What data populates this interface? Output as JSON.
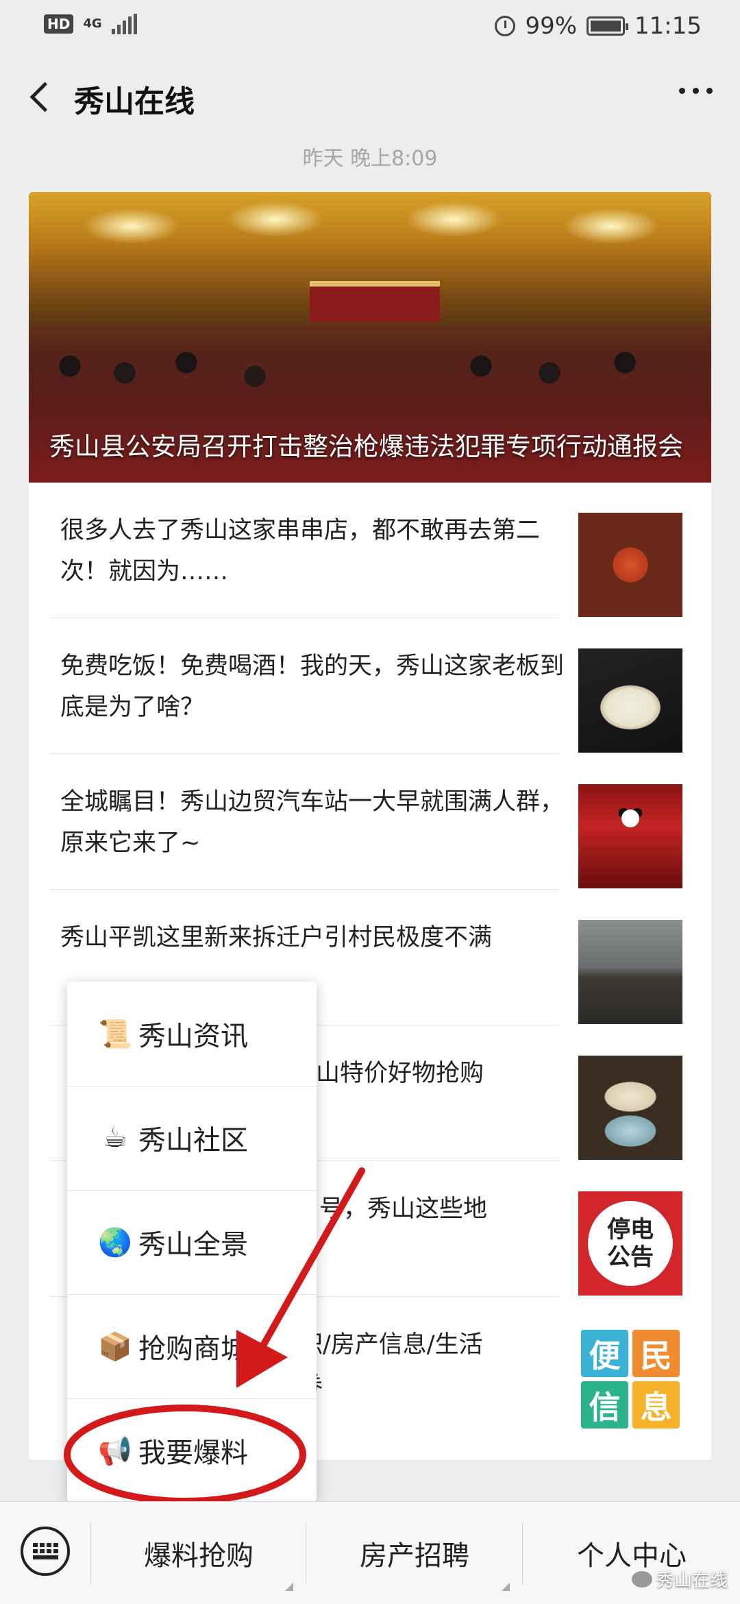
{
  "status_bar": {
    "hd": "HD",
    "network": "4G",
    "battery_percent": "99%",
    "time": "11:15"
  },
  "header": {
    "title": "秀山在线"
  },
  "message": {
    "timestamp": "昨天 晚上8:09",
    "hero_title": "秀山县公安局召开打击整治枪爆违法犯罪专项行动通报会",
    "articles": [
      {
        "title": "很多人去了秀山这家串串店，都不敢再去第二次！就因为……",
        "thumb": "food-icon"
      },
      {
        "title": "免费吃饭！免费喝酒！我的天，秀山这家老板到底是为了啥？",
        "thumb": "rice-icon"
      },
      {
        "title": "全城瞩目！秀山边贸汽车站一大早就围满人群，原来它来了~",
        "thumb": "stage-icon"
      },
      {
        "title": "秀山平凯这里新来拆迁户引村民极度不满",
        "thumb": "landscape-icon"
      },
      {
        "title": "秀山特价好物抢购",
        "thumb": "hotpot-icon"
      },
      {
        "title": "号，秀山这些地",
        "thumb": "power-notice-icon",
        "thumb_text": [
          "停电",
          "公告"
        ]
      },
      {
        "title": "职/房产信息/生活",
        "title2": "券",
        "thumb": "bianmin-icon",
        "thumb_text": [
          "便",
          "民",
          "信",
          "息"
        ]
      }
    ]
  },
  "popup_menu": {
    "items": [
      {
        "emoji": "📜",
        "label": "秀山资讯"
      },
      {
        "emoji": "☕",
        "label": "秀山社区"
      },
      {
        "emoji": "🌏",
        "label": "秀山全景"
      },
      {
        "emoji": "📦",
        "label": "抢购商城"
      },
      {
        "emoji": "📢",
        "label": "我要爆料"
      }
    ]
  },
  "bottom_bar": {
    "tabs": [
      "爆料抢购",
      "房产招聘",
      "个人中心"
    ],
    "watermark": "秀山在线"
  },
  "annotation": {
    "color": "#d4191b"
  }
}
